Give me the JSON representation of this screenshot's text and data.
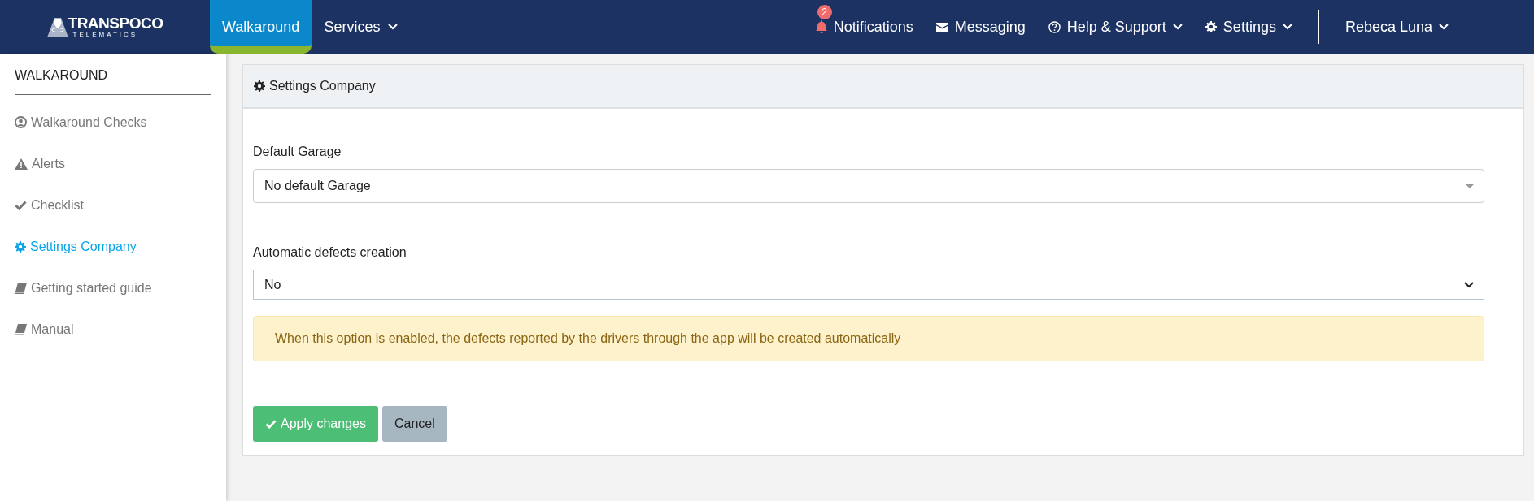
{
  "logo": {
    "name": "TRANSPOCO",
    "tagline": "TELEMATICS"
  },
  "nav": [
    {
      "label": "Walkaround",
      "selected": true,
      "dropdown": false
    },
    {
      "label": "Services",
      "selected": false,
      "dropdown": true
    }
  ],
  "top_right": [
    {
      "kind": "bell",
      "label": "Notifications",
      "badge": "2",
      "dropdown": false
    },
    {
      "kind": "envelope",
      "label": "Messaging",
      "dropdown": false
    },
    {
      "kind": "help",
      "label": "Help & Support",
      "dropdown": true
    },
    {
      "kind": "gear",
      "label": "Settings",
      "dropdown": true
    }
  ],
  "user": {
    "name": "Rebeca Luna"
  },
  "sidebar": {
    "title": "WALKAROUND",
    "items": [
      {
        "kind": "user",
        "label": "Walkaround Checks",
        "selected": false
      },
      {
        "kind": "warning",
        "label": "Alerts",
        "selected": false
      },
      {
        "kind": "check",
        "label": "Checklist",
        "selected": false
      },
      {
        "kind": "gear",
        "label": "Settings Company",
        "selected": true
      },
      {
        "kind": "book",
        "label": "Getting started guide",
        "selected": false
      },
      {
        "kind": "book",
        "label": "Manual",
        "selected": false
      }
    ]
  },
  "panel": {
    "title": "Settings Company",
    "fields": [
      {
        "kind": "combo",
        "label": "Default Garage",
        "value": "No default Garage"
      },
      {
        "kind": "select",
        "label": "Automatic defects creation",
        "value": "No"
      }
    ],
    "alert": "When this option is enabled, the defects reported by the drivers through the app will be created automatically",
    "buttons": [
      {
        "kind": "primary",
        "label": "Apply changes"
      },
      {
        "kind": "secondary",
        "label": "Cancel"
      }
    ]
  }
}
